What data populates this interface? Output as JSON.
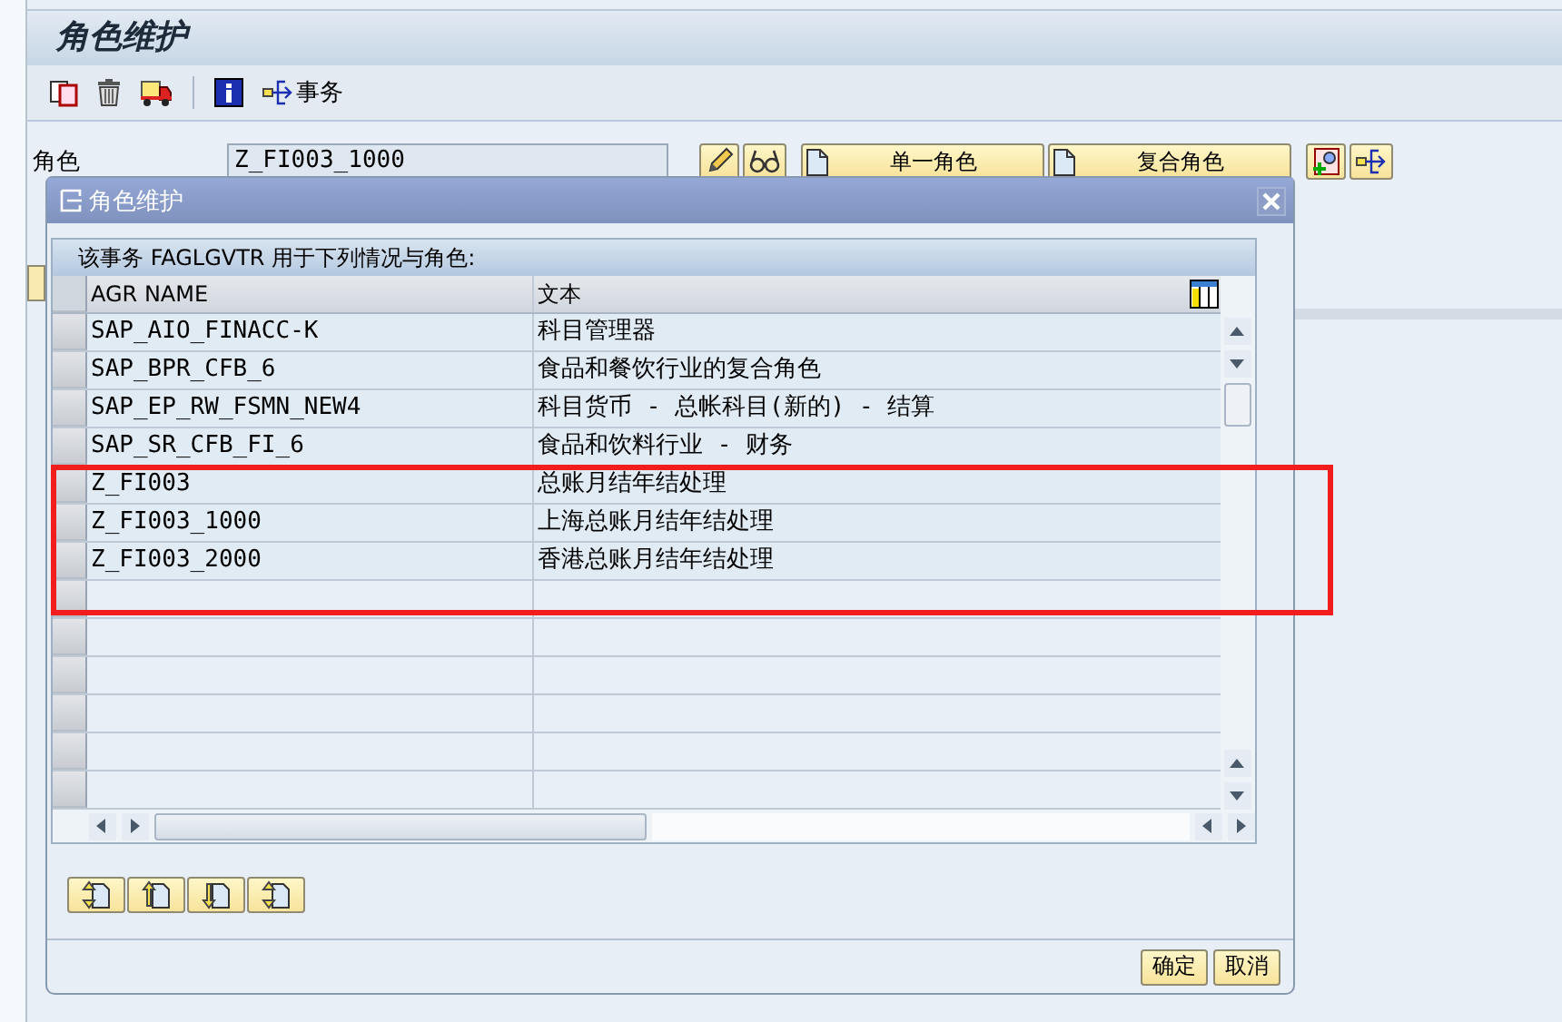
{
  "window": {
    "title": "角色维护"
  },
  "toolbar": [
    {
      "kind": "copy"
    },
    {
      "kind": "trash"
    },
    {
      "kind": "truck"
    },
    {
      "kind": "separator"
    },
    {
      "kind": "info"
    },
    {
      "kind": "transaction",
      "label": "事务"
    }
  ],
  "role_field": {
    "label": "角色",
    "value": "Z_FI003_1000"
  },
  "role_buttons": [
    {
      "kind": "pencil"
    },
    {
      "kind": "glasses"
    },
    {
      "kind": "document",
      "label": "单一角色"
    },
    {
      "kind": "document",
      "label": "复合角色"
    },
    {
      "kind": "create"
    },
    {
      "kind": "transaction"
    }
  ],
  "dialog": {
    "title": "角色维护",
    "message": "该事务 FAGLGVTR 用于下列情况与角色:",
    "table": {
      "columns": [
        "AGR NAME",
        "文本"
      ],
      "rows": [
        [
          "SAP_AIO_FINACC-K",
          "科目管理器"
        ],
        [
          "SAP_BPR_CFB_6",
          "食品和餐饮行业的复合角色"
        ],
        [
          "SAP_EP_RW_FSMN_NEW4",
          "科目货币 - 总帐科目(新的) - 结算"
        ],
        [
          "SAP_SR_CFB_FI_6",
          "食品和饮料行业 - 财务"
        ],
        [
          "Z_FI003",
          "总账月结年结处理"
        ],
        [
          "Z_FI003_1000",
          "上海总账月结年结处理"
        ],
        [
          "Z_FI003_2000",
          "香港总账月结年结处理"
        ]
      ]
    },
    "tools": [
      {
        "kind": "both"
      },
      {
        "kind": "up"
      },
      {
        "kind": "down"
      },
      {
        "kind": "both"
      }
    ],
    "buttons": [
      "确定",
      "取消"
    ]
  }
}
